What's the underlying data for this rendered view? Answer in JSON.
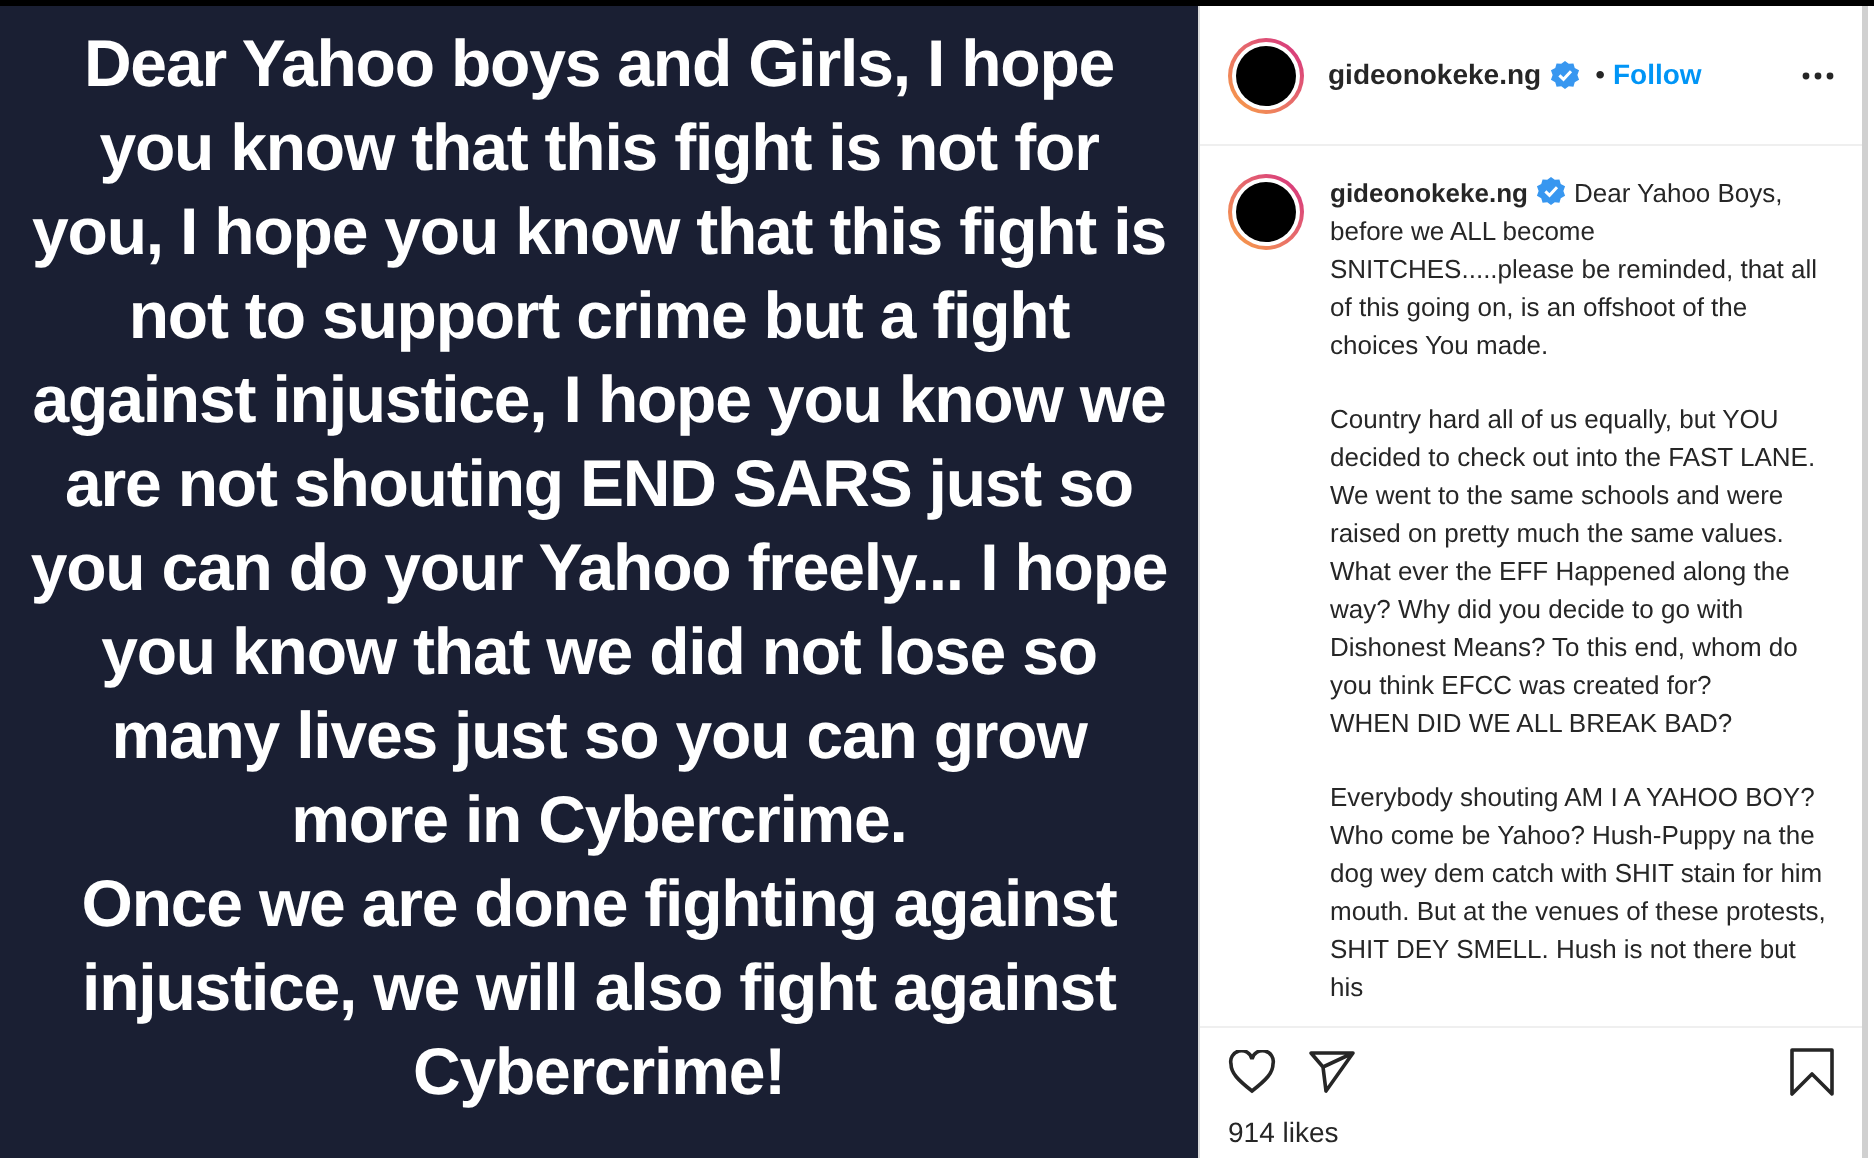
{
  "post_image": {
    "paragraphs": [
      "Dear Yahoo boys and Girls, I hope you know that this fight is not for you, I hope you know that this fight is not to support crime but a fight against injustice, I hope you know we are not shouting END SARS just so you can do your Yahoo freely... I hope you know that we did not lose so many lives just so you can grow more in Cybercrime.",
      "Once we are done fighting against injustice, we will also fight against Cybercrime!"
    ]
  },
  "header": {
    "username": "gideonokeke.ng",
    "verified": true,
    "separator": "•",
    "follow": "Follow"
  },
  "caption": {
    "username": "gideonokeke.ng",
    "verified": true,
    "paragraphs": [
      "Dear Yahoo Boys, before we ALL become SNITCHES.....please be reminded, that all of this going on, is an offshoot of the choices You made.",
      "Country hard all of us equally, but YOU decided to check out into the FAST LANE. We went to the same schools and were raised on pretty much the same values. What ever the EFF Happened along the way? Why did you decide to go with Dishonest Means? To this end, whom do you think EFCC was created for?\nWHEN DID WE ALL BREAK BAD?",
      "Everybody shouting AM I A YAHOO BOY? Who come be Yahoo? Hush-Puppy na the dog wey dem catch with SHIT stain for him mouth. But at the venues of these protests, SHIT DEY SMELL. Hush is not there but his"
    ]
  },
  "likes": "914 likes"
}
